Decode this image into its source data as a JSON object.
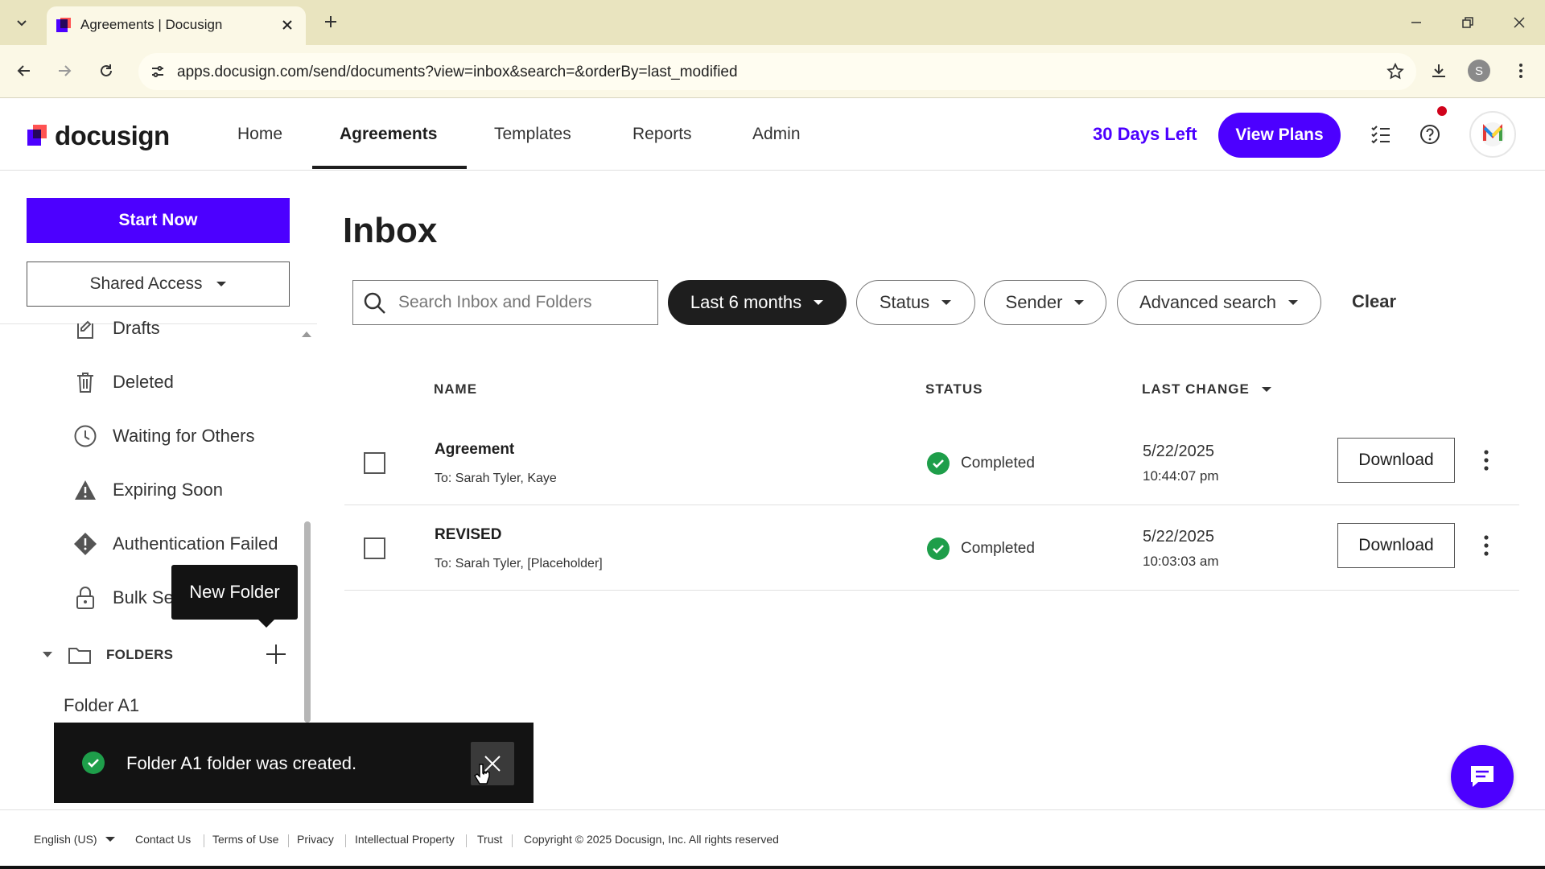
{
  "browser": {
    "tab_title": "Agreements | Docusign",
    "url": "apps.docusign.com/send/documents?view=inbox&search=&orderBy=last_modified",
    "profile_initial": "S"
  },
  "header": {
    "logo_text": "docusign",
    "nav": [
      "Home",
      "Agreements",
      "Templates",
      "Reports",
      "Admin"
    ],
    "active_nav": "Agreements",
    "trial_text": "30 Days Left",
    "view_plans_label": "View Plans"
  },
  "sidebar": {
    "start_now_label": "Start Now",
    "shared_access_label": "Shared Access",
    "items": [
      {
        "label": "Drafts",
        "icon": "drafts-icon"
      },
      {
        "label": "Deleted",
        "icon": "trash-icon"
      },
      {
        "label": "Waiting for Others",
        "icon": "clock-icon"
      },
      {
        "label": "Expiring Soon",
        "icon": "warning-icon"
      },
      {
        "label": "Authentication Failed",
        "icon": "alert-diamond-icon"
      },
      {
        "label": "Bulk Se",
        "icon": "lock-icon"
      }
    ],
    "folders_label": "FOLDERS",
    "folder_items": [
      "Folder A1"
    ],
    "tooltip": "New Folder"
  },
  "main": {
    "title": "Inbox",
    "search_placeholder": "Search Inbox and Folders",
    "filters": {
      "date": "Last 6 months",
      "status": "Status",
      "sender": "Sender",
      "advanced": "Advanced search",
      "clear": "Clear"
    },
    "columns": {
      "name": "NAME",
      "status": "STATUS",
      "last_change": "LAST CHANGE"
    },
    "rows": [
      {
        "name": "Agreement",
        "to": "To: Sarah Tyler, Kaye",
        "status": "Completed",
        "date": "5/22/2025",
        "time": "10:44:07 pm",
        "action": "Download"
      },
      {
        "name": "REVISED",
        "to": "To: Sarah Tyler, [Placeholder]",
        "status": "Completed",
        "date": "5/22/2025",
        "time": "10:03:03 am",
        "action": "Download"
      }
    ]
  },
  "toast": {
    "message": "Folder A1 folder was created."
  },
  "footer": {
    "language": "English (US)",
    "links": [
      "Contact Us",
      "Terms of Use",
      "Privacy",
      "Intellectual Property",
      "Trust"
    ],
    "copyright": "Copyright © 2025 Docusign, Inc. All rights reserved"
  },
  "colors": {
    "brand": "#4c00ff",
    "success": "#1e9e4a",
    "dark": "#131313"
  }
}
